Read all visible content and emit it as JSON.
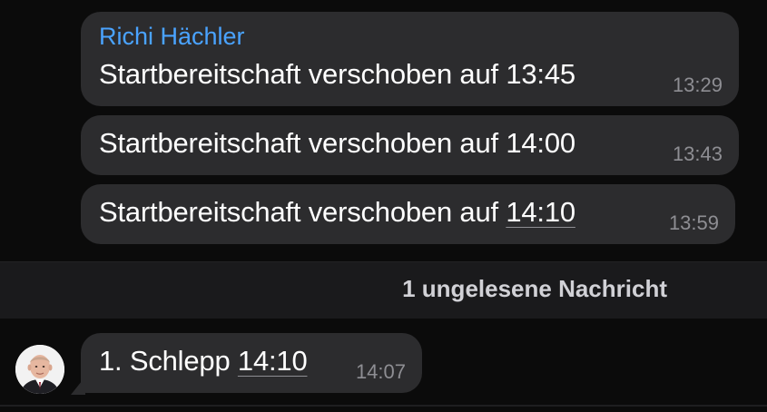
{
  "messages": [
    {
      "sender": "Richi Hächler",
      "text": "Startbereitschaft verschoben auf 13:45",
      "time": "13:29"
    },
    {
      "text": "Startbereitschaft verschoben auf 14:00",
      "time": "13:43"
    },
    {
      "text_prefix": "Startbereitschaft verschoben auf ",
      "link": "14:10",
      "time": "13:59"
    }
  ],
  "divider": {
    "label": "1 ungelesene Nachricht"
  },
  "incoming": {
    "text_prefix": "1. Schlepp ",
    "link": "14:10",
    "time": "14:07",
    "avatar_icon": "person-avatar"
  },
  "colors": {
    "background": "#0b0b0b",
    "bubble": "#2c2c2e",
    "sender": "#4aa3ff",
    "timestamp": "#8e8e93",
    "divider_bg": "#1a1a1c"
  }
}
